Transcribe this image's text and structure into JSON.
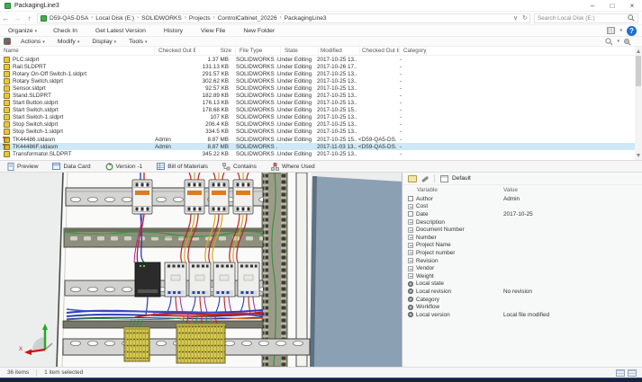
{
  "window": {
    "title": "PackagingLine3",
    "controls": {
      "minimize": "–",
      "maximize": "□",
      "close": "×"
    }
  },
  "address_bar": {
    "nav": {
      "back": "←",
      "forward": "→",
      "up": "↑",
      "dropdown": "∨",
      "refresh": "↻"
    },
    "breadcrumbs": [
      {
        "label": "D59-QA5-DSA",
        "sep": "›"
      },
      {
        "label": "Local Disk (E:)",
        "sep": "›"
      },
      {
        "label": "SOLIDWORKS",
        "sep": "›"
      },
      {
        "label": "Projects",
        "sep": "›"
      },
      {
        "label": "ControlCabinet_20226",
        "sep": "›"
      },
      {
        "label": "PackagingLine3",
        "sep": ""
      }
    ],
    "search_placeholder": "Search Local Disk (E:)"
  },
  "command_bar": {
    "items": [
      {
        "label": "Organize",
        "caret": "▾"
      },
      {
        "label": "Check In"
      },
      {
        "label": "Get Latest Version"
      },
      {
        "label": "History"
      },
      {
        "label": "View File"
      },
      {
        "label": "New Folder"
      }
    ],
    "help_glyph": "?"
  },
  "menu_bar": {
    "items": [
      {
        "label": "Actions",
        "caret": "▾"
      },
      {
        "label": "Modify",
        "caret": "▾"
      },
      {
        "label": "Display",
        "caret": "▾"
      },
      {
        "label": "Tools",
        "caret": "▾"
      }
    ]
  },
  "file_list": {
    "columns": [
      "Name",
      "Checked Out By",
      "Size",
      "File Type",
      "State",
      "Modified",
      "Checked Out In",
      "Category"
    ],
    "files": [
      {
        "name": "PLC.sldprt",
        "checked_out_by": "",
        "size": "1.37 MB",
        "file_type": "SOLIDWORKS ...",
        "state": "Under Editing",
        "modified": "2017-10-25 13...",
        "checked_out_in": "",
        "category": "-",
        "kind": "part"
      },
      {
        "name": "Rail.SLDPRT",
        "checked_out_by": "",
        "size": "131.13 KB",
        "file_type": "SOLIDWORKS ...",
        "state": "Under Editing",
        "modified": "2017-10-26 17...",
        "checked_out_in": "",
        "category": "-",
        "kind": "part"
      },
      {
        "name": "Rotary On-Off Switch-1.sldprt",
        "checked_out_by": "",
        "size": "291.57 KB",
        "file_type": "SOLIDWORKS ...",
        "state": "Under Editing",
        "modified": "2017-10-25 13...",
        "checked_out_in": "",
        "category": "-",
        "kind": "part"
      },
      {
        "name": "Rotary Switch.sldprt",
        "checked_out_by": "",
        "size": "302.62 KB",
        "file_type": "SOLIDWORKS ...",
        "state": "Under Editing",
        "modified": "2017-10-25 13...",
        "checked_out_in": "",
        "category": "-",
        "kind": "part"
      },
      {
        "name": "Sensor.sldprt",
        "checked_out_by": "",
        "size": "92.57 KB",
        "file_type": "SOLIDWORKS ...",
        "state": "Under Editing",
        "modified": "2017-10-25 13...",
        "checked_out_in": "",
        "category": "-",
        "kind": "part"
      },
      {
        "name": "Stand.SLDPRT",
        "checked_out_by": "",
        "size": "182.89 KB",
        "file_type": "SOLIDWORKS ...",
        "state": "Under Editing",
        "modified": "2017-10-25 13...",
        "checked_out_in": "",
        "category": "-",
        "kind": "part"
      },
      {
        "name": "Start Button.sldprt",
        "checked_out_by": "",
        "size": "176.13 KB",
        "file_type": "SOLIDWORKS ...",
        "state": "Under Editing",
        "modified": "2017-10-25 13...",
        "checked_out_in": "",
        "category": "-",
        "kind": "part"
      },
      {
        "name": "Start Switch.sldprt",
        "checked_out_by": "",
        "size": "178.68 KB",
        "file_type": "SOLIDWORKS ...",
        "state": "Under Editing",
        "modified": "2017-10-25 15...",
        "checked_out_in": "",
        "category": "-",
        "kind": "part"
      },
      {
        "name": "Start Switch-1.sldprt",
        "checked_out_by": "",
        "size": "107 KB",
        "file_type": "SOLIDWORKS ...",
        "state": "Under Editing",
        "modified": "2017-10-25 13...",
        "checked_out_in": "",
        "category": "-",
        "kind": "part"
      },
      {
        "name": "Stop Switch.sldprt",
        "checked_out_by": "",
        "size": "206.4 KB",
        "file_type": "SOLIDWORKS ...",
        "state": "Under Editing",
        "modified": "2017-10-25 13...",
        "checked_out_in": "",
        "category": "-",
        "kind": "part"
      },
      {
        "name": "Stop Switch-1.sldprt",
        "checked_out_by": "",
        "size": "334.5 KB",
        "file_type": "SOLIDWORKS ...",
        "state": "Under Editing",
        "modified": "2017-10-25 13...",
        "checked_out_in": "",
        "category": "-",
        "kind": "part"
      },
      {
        "name": "TK44486.sldasm",
        "checked_out_by": "Admin",
        "size": "8.87 MB",
        "file_type": "SOLIDWORKS ...",
        "state": "Under Editing",
        "modified": "2017-10-25 15...",
        "checked_out_in": "<D59-QA5-DS...",
        "category": "-",
        "kind": "assembly",
        "checked": true
      },
      {
        "name": "TK44486F.sldasm",
        "checked_out_by": "Admin",
        "size": "8.87 MB",
        "file_type": "SOLIDWORKS ...",
        "state": "",
        "modified": "2017-11-03 13...",
        "checked_out_in": "<D59-QA5-DS...",
        "category": "-",
        "kind": "assembly",
        "checked": true,
        "selected": true
      },
      {
        "name": "Transformator.SLDPRT",
        "checked_out_by": "",
        "size": "345.22 KB",
        "file_type": "SOLIDWORKS ...",
        "state": "Under Editing",
        "modified": "2017-10-25 13...",
        "checked_out_in": "",
        "category": "-",
        "kind": "part"
      }
    ]
  },
  "tab_bar": {
    "tabs": [
      {
        "label": "Preview"
      },
      {
        "label": "Data Card"
      },
      {
        "label": "Version -1"
      },
      {
        "label": "Bill of Materials"
      },
      {
        "label": "Contains"
      },
      {
        "label": "Where Used"
      }
    ]
  },
  "preview": {
    "axis_x_label": "X"
  },
  "data_card": {
    "config_label": "Default",
    "columns": {
      "variable": "Variable",
      "value": "Value"
    },
    "rows": [
      {
        "icon": "doc",
        "variable": "Author",
        "value": "Admin"
      },
      {
        "icon": "abc",
        "variable": "Cost",
        "value": ""
      },
      {
        "icon": "doc",
        "variable": "Date",
        "value": "2017-10-25"
      },
      {
        "icon": "abc",
        "variable": "Description",
        "value": ""
      },
      {
        "icon": "abc",
        "variable": "Document Number",
        "value": ""
      },
      {
        "icon": "abc",
        "variable": "Number",
        "value": ""
      },
      {
        "icon": "abc",
        "variable": "Project Name",
        "value": ""
      },
      {
        "icon": "abc",
        "variable": "Project number",
        "value": ""
      },
      {
        "icon": "abc",
        "variable": "Revision",
        "value": ""
      },
      {
        "icon": "abc",
        "variable": "Vendor",
        "value": ""
      },
      {
        "icon": "abc",
        "variable": "Weight",
        "value": ""
      },
      {
        "icon": "gear",
        "variable": "Local state",
        "value": ""
      },
      {
        "icon": "gear",
        "variable": "Local revision",
        "value": "No revision"
      },
      {
        "icon": "gear",
        "variable": "Category",
        "value": ""
      },
      {
        "icon": "gear",
        "variable": "Workflow",
        "value": ""
      },
      {
        "icon": "gear",
        "variable": "Local version",
        "value": "Local file modified"
      }
    ]
  },
  "status_bar": {
    "items_count": "36 items",
    "selection_count": "1 item selected"
  },
  "colors": {
    "selection_bg": "#cde8f6",
    "vault_green": "#3fae49",
    "help_blue": "#1d6fd0",
    "accent_navy": "#16233f"
  }
}
